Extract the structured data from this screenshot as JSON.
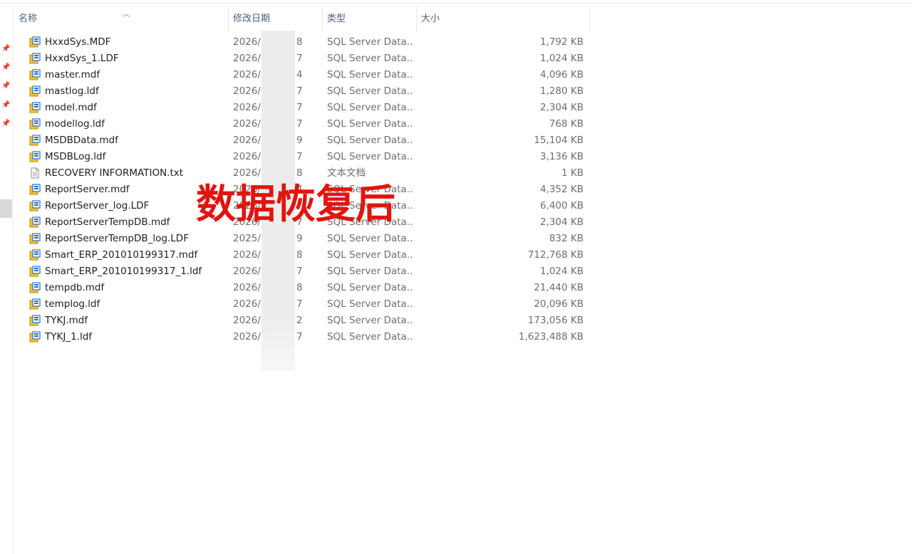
{
  "columns": {
    "name": "名称",
    "date": "修改日期",
    "type": "类型",
    "size": "大小"
  },
  "icons": {
    "db_file": "database-file-icon",
    "text_file": "text-document-icon",
    "pin": "pin-icon",
    "sort": "sort-up-icon"
  },
  "files": [
    {
      "name": "HxxdSys.MDF",
      "date_prefix": "2026/",
      "date_suffix": "8",
      "type": "SQL Server Data...",
      "size": "1,792 KB",
      "icon": "database-file-icon"
    },
    {
      "name": "HxxdSys_1.LDF",
      "date_prefix": "2026/",
      "date_suffix": "7",
      "type": "SQL Server Data...",
      "size": "1,024 KB",
      "icon": "database-file-icon"
    },
    {
      "name": "master.mdf",
      "date_prefix": "2026/3",
      "date_suffix": "4",
      "type": "SQL Server Data...",
      "size": "4,096 KB",
      "icon": "database-file-icon"
    },
    {
      "name": "mastlog.ldf",
      "date_prefix": "2026/3",
      "date_suffix": "7",
      "type": "SQL Server Data...",
      "size": "1,280 KB",
      "icon": "database-file-icon"
    },
    {
      "name": "model.mdf",
      "date_prefix": "2026/3",
      "date_suffix": "7",
      "type": "SQL Server Data...",
      "size": "2,304 KB",
      "icon": "database-file-icon"
    },
    {
      "name": "modellog.ldf",
      "date_prefix": "2026/3",
      "date_suffix": "7",
      "type": "SQL Server Data...",
      "size": "768 KB",
      "icon": "database-file-icon"
    },
    {
      "name": "MSDBData.mdf",
      "date_prefix": "2026/",
      "date_suffix": "9",
      "type": "SQL Server Data...",
      "size": "15,104 KB",
      "icon": "database-file-icon"
    },
    {
      "name": "MSDBLog.ldf",
      "date_prefix": "2026/3",
      "date_suffix": "7",
      "type": "SQL Server Data...",
      "size": "3,136 KB",
      "icon": "database-file-icon"
    },
    {
      "name": "RECOVERY INFORMATION.txt",
      "date_prefix": "2026/3",
      "date_suffix": "8",
      "type": "文本文档",
      "size": "1 KB",
      "icon": "text-document-icon"
    },
    {
      "name": "ReportServer.mdf",
      "date_prefix": "2026/",
      "date_suffix": "4",
      "type": "SQL Server Data...",
      "size": "4,352 KB",
      "icon": "database-file-icon"
    },
    {
      "name": "ReportServer_log.LDF",
      "date_prefix": "2026/",
      "date_suffix": "7",
      "type": "SQL Server Data...",
      "size": "6,400 KB",
      "icon": "database-file-icon"
    },
    {
      "name": "ReportServerTempDB.mdf",
      "date_prefix": "2026/",
      "date_suffix": "7",
      "type": "SQL Server Data...",
      "size": "2,304 KB",
      "icon": "database-file-icon"
    },
    {
      "name": "ReportServerTempDB_log.LDF",
      "date_prefix": "2025/",
      "date_suffix": "9",
      "type": "SQL Server Data...",
      "size": "832 KB",
      "icon": "database-file-icon"
    },
    {
      "name": "Smart_ERP_201010199317.mdf",
      "date_prefix": "2026/3",
      "date_suffix": "8",
      "type": "SQL Server Data...",
      "size": "712,768 KB",
      "icon": "database-file-icon"
    },
    {
      "name": "Smart_ERP_201010199317_1.ldf",
      "date_prefix": "2026/3",
      "date_suffix": "7",
      "type": "SQL Server Data...",
      "size": "1,024 KB",
      "icon": "database-file-icon"
    },
    {
      "name": "tempdb.mdf",
      "date_prefix": "2026/3",
      "date_suffix": "8",
      "type": "SQL Server Data...",
      "size": "21,440 KB",
      "icon": "database-file-icon"
    },
    {
      "name": "templog.ldf",
      "date_prefix": "2026/3",
      "date_suffix": "7",
      "type": "SQL Server Data...",
      "size": "20,096 KB",
      "icon": "database-file-icon"
    },
    {
      "name": "TYKJ.mdf",
      "date_prefix": "2026/3",
      "date_suffix": "2",
      "type": "SQL Server Data...",
      "size": "173,056 KB",
      "icon": "database-file-icon"
    },
    {
      "name": "TYKJ_1.ldf",
      "date_prefix": "2026/",
      "date_suffix": "7",
      "type": "SQL Server Data...",
      "size": "1,623,488 KB",
      "icon": "database-file-icon"
    }
  ],
  "watermark": "数据恢复后",
  "colors": {
    "watermark": "#e0150f",
    "header_text": "#4c607a",
    "icon_yellow": "#f2c231",
    "icon_blue": "#2f6fc2"
  }
}
